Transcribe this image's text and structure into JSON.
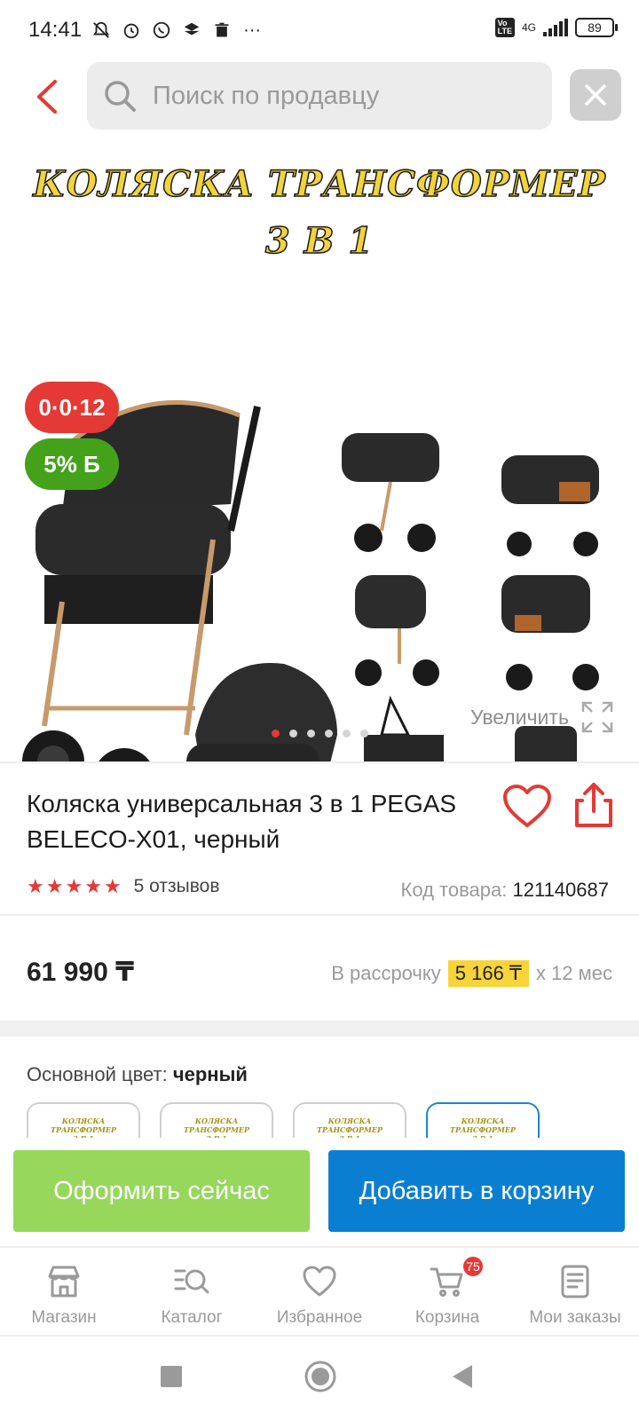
{
  "status_bar": {
    "time": "14:41",
    "network": "4G",
    "battery": "89"
  },
  "header": {
    "search_placeholder": "Поиск по продавцу"
  },
  "gallery": {
    "promo_line1": "КОЛЯСКА ТРАНСФОРМЕР",
    "promo_line2": "3 В 1",
    "badge_installment": "0·0·12",
    "badge_bonus": "5% Б",
    "zoom_label": "Увеличить",
    "image_count": 6,
    "active_image": 1
  },
  "product": {
    "title": "Коляска универсальная 3 в 1 PEGAS BELECO-X01, черный",
    "rating": 5,
    "reviews": "5 отзывов",
    "code_label": "Код товара:",
    "code_value": "121140687",
    "price": "61 990 ₸",
    "installment_prefix": "В рассрочку",
    "installment_amount": "5 166 ₸",
    "installment_suffix": "х 12 мес"
  },
  "color_selector": {
    "label": "Основной цвет:",
    "value": "черный",
    "swatch_text_line1": "КОЛЯСКА ТРАНСФОРМЕР",
    "swatch_text_line2": "3 В 1"
  },
  "actions": {
    "buy_now": "Оформить сейчас",
    "add_to_cart": "Добавить в корзину"
  },
  "bottom_nav": {
    "items": [
      {
        "label": "Магазин",
        "icon": "shop-icon"
      },
      {
        "label": "Каталог",
        "icon": "catalog-search-icon"
      },
      {
        "label": "Избранное",
        "icon": "heart-icon"
      },
      {
        "label": "Корзина",
        "icon": "cart-icon"
      },
      {
        "label": "Мои заказы",
        "icon": "orders-icon"
      }
    ],
    "cart_count": "75"
  },
  "colors": {
    "accent_red": "#e53935",
    "buy_green": "#96d75c",
    "cart_blue": "#0a7fd1",
    "highlight_yellow": "#f7d43a"
  }
}
